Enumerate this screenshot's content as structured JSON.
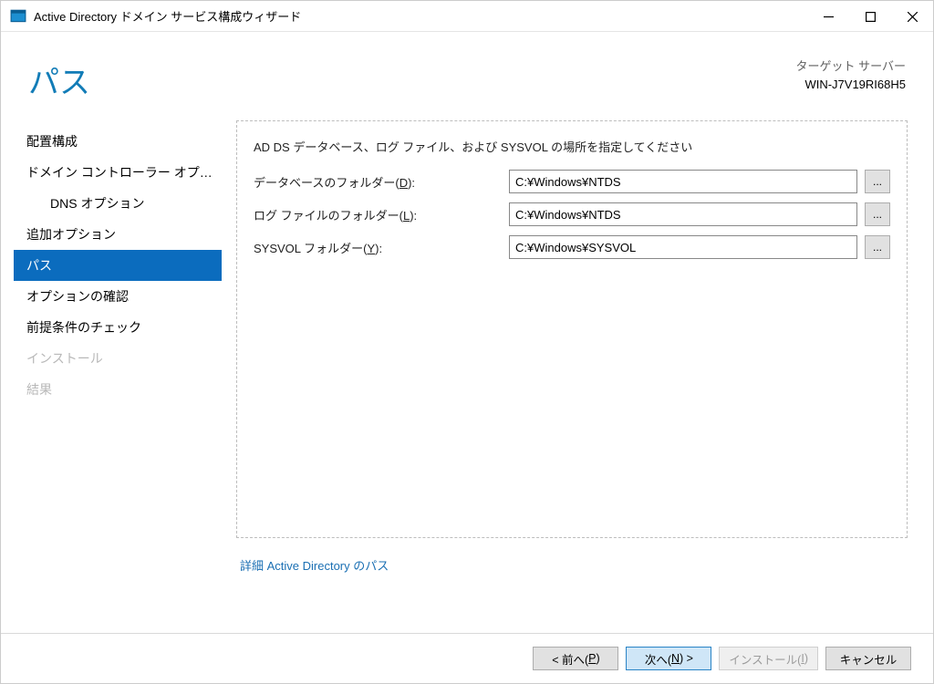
{
  "window": {
    "title": "Active Directory ドメイン サービス構成ウィザード"
  },
  "header": {
    "page_title": "パス",
    "target_label": "ターゲット サーバー",
    "target_name": "WIN-J7V19RI68H5"
  },
  "sidebar": {
    "items": [
      {
        "label": "配置構成"
      },
      {
        "label": "ドメイン コントローラー オプシ..."
      },
      {
        "label": "DNS オプション",
        "indent": true
      },
      {
        "label": "追加オプション"
      },
      {
        "label": "パス",
        "active": true
      },
      {
        "label": "オプションの確認"
      },
      {
        "label": "前提条件のチェック"
      },
      {
        "label": "インストール",
        "disabled": true
      },
      {
        "label": "結果",
        "disabled": true
      }
    ]
  },
  "main": {
    "instruction": "AD DS データベース、ログ ファイル、および SYSVOL の場所を指定してください",
    "fields": [
      {
        "label_pre": "データベースのフォルダー(",
        "hotkey": "D",
        "label_post": "):",
        "value": "C:¥Windows¥NTDS",
        "name": "database-folder"
      },
      {
        "label_pre": "ログ ファイルのフォルダー(",
        "hotkey": "L",
        "label_post": "):",
        "value": "C:¥Windows¥NTDS",
        "name": "log-folder"
      },
      {
        "label_pre": "SYSVOL フォルダー(",
        "hotkey": "Y",
        "label_post": "):",
        "value": "C:¥Windows¥SYSVOL",
        "name": "sysvol-folder"
      }
    ],
    "browse": "...",
    "more_link": "詳細 Active Directory のパス"
  },
  "footer": {
    "prev_pre": "< 前へ(",
    "prev_hot": "P",
    "prev_post": ")",
    "next_pre": "次へ(",
    "next_hot": "N",
    "next_post": ") >",
    "install_pre": "インストール(",
    "install_hot": "I",
    "install_post": ")",
    "cancel": "キャンセル"
  }
}
